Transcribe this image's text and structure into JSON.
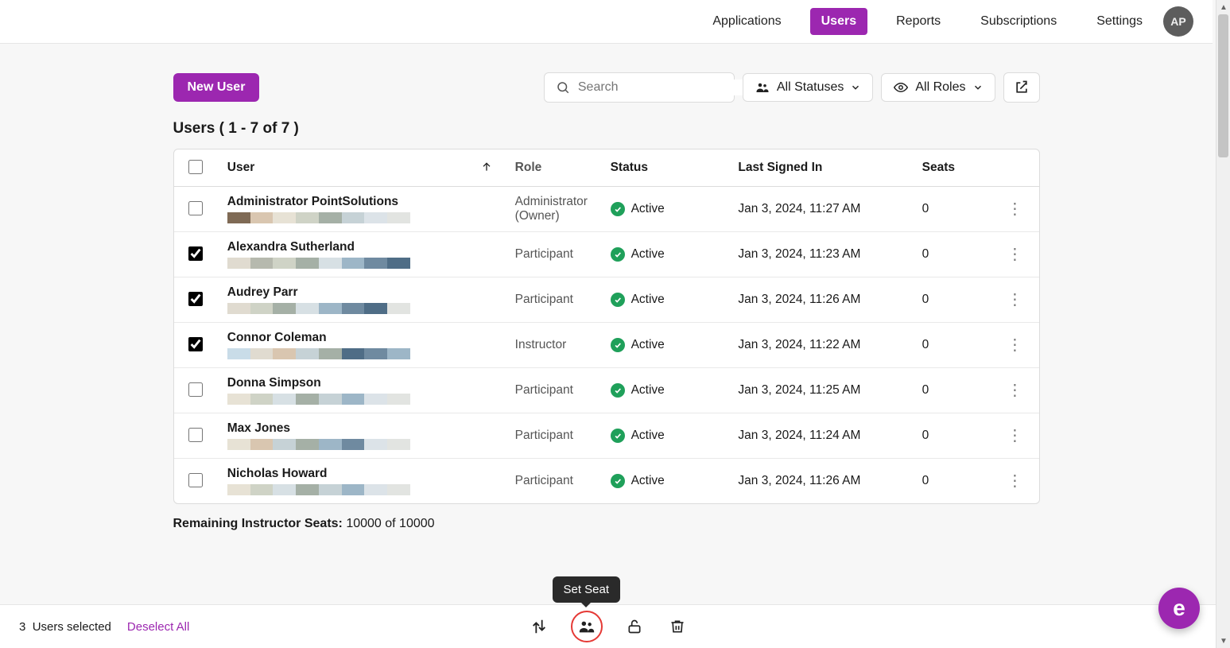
{
  "nav": {
    "items": [
      {
        "label": "Applications",
        "active": false
      },
      {
        "label": "Users",
        "active": true
      },
      {
        "label": "Reports",
        "active": false
      },
      {
        "label": "Subscriptions",
        "active": false
      },
      {
        "label": "Settings",
        "active": false
      }
    ],
    "avatar": "AP"
  },
  "toolbar": {
    "new_user": "New User",
    "search_placeholder": "Search",
    "status_filter": "All Statuses",
    "role_filter": "All Roles"
  },
  "list": {
    "title": "Users ( 1 - 7 of 7 )",
    "columns": {
      "user": "User",
      "role": "Role",
      "status": "Status",
      "signed": "Last Signed In",
      "seats": "Seats"
    }
  },
  "rows": [
    {
      "checked": false,
      "name": "Administrator PointSolutions",
      "role": "Administrator (Owner)",
      "status": "Active",
      "signed": "Jan 3, 2024, 11:27 AM",
      "seats": "0",
      "colors": [
        "#7f6a55",
        "#d9c6b0",
        "#e7e2d5",
        "#cfd3c6",
        "#a5b0a6",
        "#c6d2d6",
        "#dce3e8",
        "#e2e4e1"
      ]
    },
    {
      "checked": true,
      "name": "Alexandra Sutherland",
      "role": "Participant",
      "status": "Active",
      "signed": "Jan 3, 2024, 11:23 AM",
      "seats": "0",
      "colors": [
        "#e0dbd0",
        "#b6b9ae",
        "#cfd3c6",
        "#a5b0a6",
        "#d7e0e4",
        "#9db6c7",
        "#6f8aa0",
        "#4f6d86"
      ]
    },
    {
      "checked": true,
      "name": "Audrey Parr",
      "role": "Participant",
      "status": "Active",
      "signed": "Jan 3, 2024, 11:26 AM",
      "seats": "0",
      "colors": [
        "#e0dbd0",
        "#cfd3c6",
        "#a5b0a6",
        "#d7e0e4",
        "#9db6c7",
        "#6f8aa0",
        "#4f6d86",
        "#e2e4e1"
      ]
    },
    {
      "checked": true,
      "name": "Connor Coleman",
      "role": "Instructor",
      "status": "Active",
      "signed": "Jan 3, 2024, 11:22 AM",
      "seats": "0",
      "colors": [
        "#c9dce8",
        "#e0dbd0",
        "#d9c6b0",
        "#c6d2d6",
        "#a5b0a6",
        "#4f6d86",
        "#6f8aa0",
        "#9db6c7"
      ]
    },
    {
      "checked": false,
      "name": "Donna Simpson",
      "role": "Participant",
      "status": "Active",
      "signed": "Jan 3, 2024, 11:25 AM",
      "seats": "0",
      "colors": [
        "#e7e2d5",
        "#cfd3c6",
        "#d7e0e4",
        "#a5b0a6",
        "#c6d2d6",
        "#9db6c7",
        "#dce3e8",
        "#e2e4e1"
      ]
    },
    {
      "checked": false,
      "name": "Max Jones",
      "role": "Participant",
      "status": "Active",
      "signed": "Jan 3, 2024, 11:24 AM",
      "seats": "0",
      "colors": [
        "#e7e2d5",
        "#d9c6b0",
        "#c6d2d6",
        "#a5b0a6",
        "#9db6c7",
        "#6f8aa0",
        "#dce3e8",
        "#e2e4e1"
      ]
    },
    {
      "checked": false,
      "name": "Nicholas Howard",
      "role": "Participant",
      "status": "Active",
      "signed": "Jan 3, 2024, 11:26 AM",
      "seats": "0",
      "colors": [
        "#e7e2d5",
        "#cfd3c6",
        "#d7e0e4",
        "#a5b0a6",
        "#c6d2d6",
        "#9db6c7",
        "#dce3e8",
        "#e2e4e1"
      ]
    }
  ],
  "remaining": {
    "label": "Remaining Instructor Seats:",
    "value": "10000 of 10000"
  },
  "footer": {
    "selected_count": "3",
    "selected_label": "Users selected",
    "deselect": "Deselect All",
    "tooltip": "Set Seat"
  },
  "help": "e"
}
